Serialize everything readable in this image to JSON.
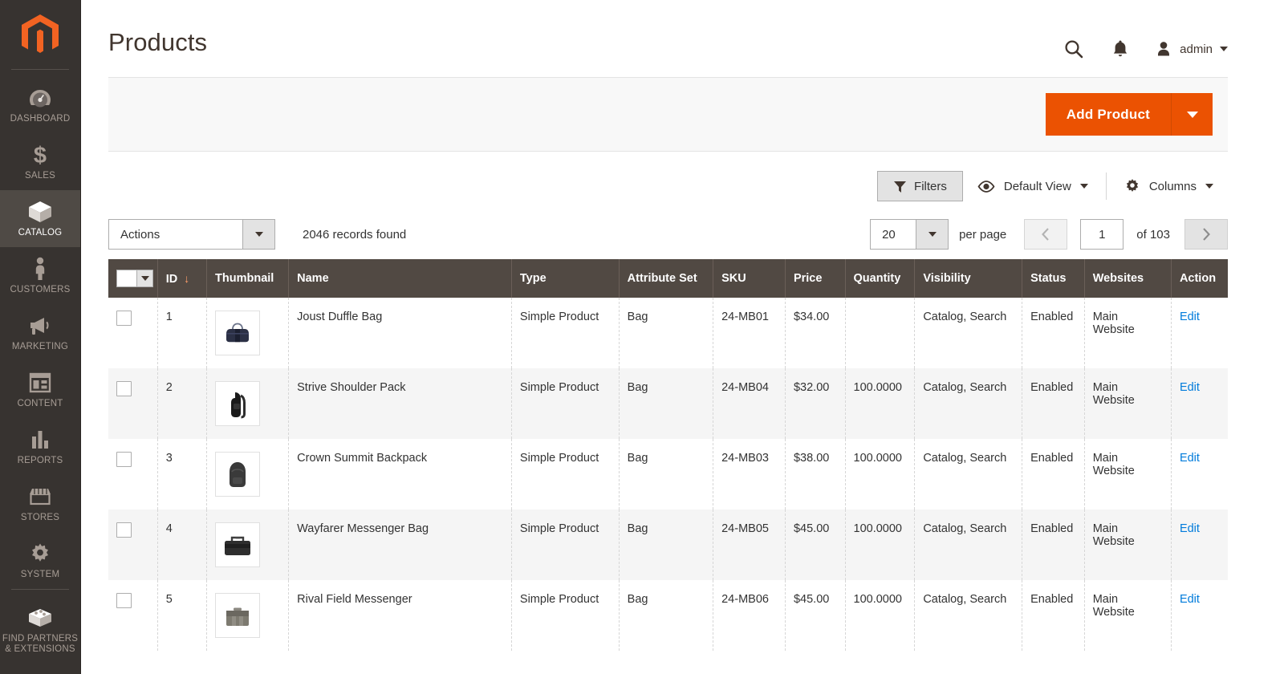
{
  "sidebar": {
    "logo_name": "magento-logo",
    "items": [
      {
        "label": "DASHBOARD",
        "icon": "dashboard-gauge-icon",
        "active": false
      },
      {
        "label": "SALES",
        "icon": "dollar-sign-icon",
        "active": false
      },
      {
        "label": "CATALOG",
        "icon": "box-icon",
        "active": true
      },
      {
        "label": "CUSTOMERS",
        "icon": "person-icon",
        "active": false
      },
      {
        "label": "MARKETING",
        "icon": "megaphone-icon",
        "active": false
      },
      {
        "label": "CONTENT",
        "icon": "layout-page-icon",
        "active": false
      },
      {
        "label": "REPORTS",
        "icon": "bar-chart-icon",
        "active": false
      },
      {
        "label": "STORES",
        "icon": "storefront-icon",
        "active": false
      },
      {
        "label": "SYSTEM",
        "icon": "gear-icon",
        "active": false
      },
      {
        "label": "FIND PARTNERS\n& EXTENSIONS",
        "label_line1": "FIND PARTNERS",
        "label_line2": "& EXTENSIONS",
        "icon": "extension-box-icon",
        "active": false
      }
    ]
  },
  "header": {
    "title": "Products",
    "search_icon": "search-icon",
    "notifications_icon": "bell-icon",
    "avatar_icon": "user-avatar-icon",
    "admin_label": "admin"
  },
  "action_panel": {
    "add_product_label": "Add Product",
    "add_product_toggle_icon": "chevron-down-icon",
    "accent_color": "#eb5202"
  },
  "grid_tools": {
    "filters_label": "Filters",
    "filters_icon": "funnel-icon",
    "view_icon": "eye-icon",
    "view_label": "Default View",
    "columns_icon": "gear-icon",
    "columns_label": "Columns"
  },
  "grid_bar": {
    "actions_label": "Actions",
    "records_found": "2046 records found",
    "per_page_value": "20",
    "per_page_label": "per page",
    "prev_icon": "chevron-left-icon",
    "next_icon": "chevron-right-icon",
    "page_value": "1",
    "of_label": "of 103"
  },
  "table": {
    "columns": [
      {
        "key": "checkbox",
        "label": ""
      },
      {
        "key": "id",
        "label": "ID",
        "sorted": true,
        "sort_dir": "desc",
        "sort_glyph": "↓"
      },
      {
        "key": "thumbnail",
        "label": "Thumbnail"
      },
      {
        "key": "name",
        "label": "Name"
      },
      {
        "key": "type",
        "label": "Type"
      },
      {
        "key": "attribute_set",
        "label": "Attribute Set"
      },
      {
        "key": "sku",
        "label": "SKU"
      },
      {
        "key": "price",
        "label": "Price"
      },
      {
        "key": "quantity",
        "label": "Quantity"
      },
      {
        "key": "visibility",
        "label": "Visibility"
      },
      {
        "key": "status",
        "label": "Status"
      },
      {
        "key": "websites",
        "label": "Websites"
      },
      {
        "key": "action",
        "label": "Action"
      }
    ],
    "rows": [
      {
        "id": "1",
        "thumb": "duffle-bag-thumbnail",
        "name": "Joust Duffle Bag",
        "type": "Simple Product",
        "attribute_set": "Bag",
        "sku": "24-MB01",
        "price": "$34.00",
        "quantity": "",
        "visibility": "Catalog, Search",
        "status": "Enabled",
        "websites": "Main Website",
        "action": "Edit"
      },
      {
        "id": "2",
        "thumb": "shoulder-pack-thumbnail",
        "name": "Strive Shoulder Pack",
        "type": "Simple Product",
        "attribute_set": "Bag",
        "sku": "24-MB04",
        "price": "$32.00",
        "quantity": "100.0000",
        "visibility": "Catalog, Search",
        "status": "Enabled",
        "websites": "Main Website",
        "action": "Edit"
      },
      {
        "id": "3",
        "thumb": "backpack-thumbnail",
        "name": "Crown Summit Backpack",
        "type": "Simple Product",
        "attribute_set": "Bag",
        "sku": "24-MB03",
        "price": "$38.00",
        "quantity": "100.0000",
        "visibility": "Catalog, Search",
        "status": "Enabled",
        "websites": "Main Website",
        "action": "Edit"
      },
      {
        "id": "4",
        "thumb": "messenger-bag-thumbnail",
        "name": "Wayfarer Messenger Bag",
        "type": "Simple Product",
        "attribute_set": "Bag",
        "sku": "24-MB05",
        "price": "$45.00",
        "quantity": "100.0000",
        "visibility": "Catalog, Search",
        "status": "Enabled",
        "websites": "Main Website",
        "action": "Edit"
      },
      {
        "id": "5",
        "thumb": "field-messenger-thumbnail",
        "name": "Rival Field Messenger",
        "type": "Simple Product",
        "attribute_set": "Bag",
        "sku": "24-MB06",
        "price": "$45.00",
        "quantity": "100.0000",
        "visibility": "Catalog, Search",
        "status": "Enabled",
        "websites": "Main Website",
        "action": "Edit"
      }
    ]
  }
}
